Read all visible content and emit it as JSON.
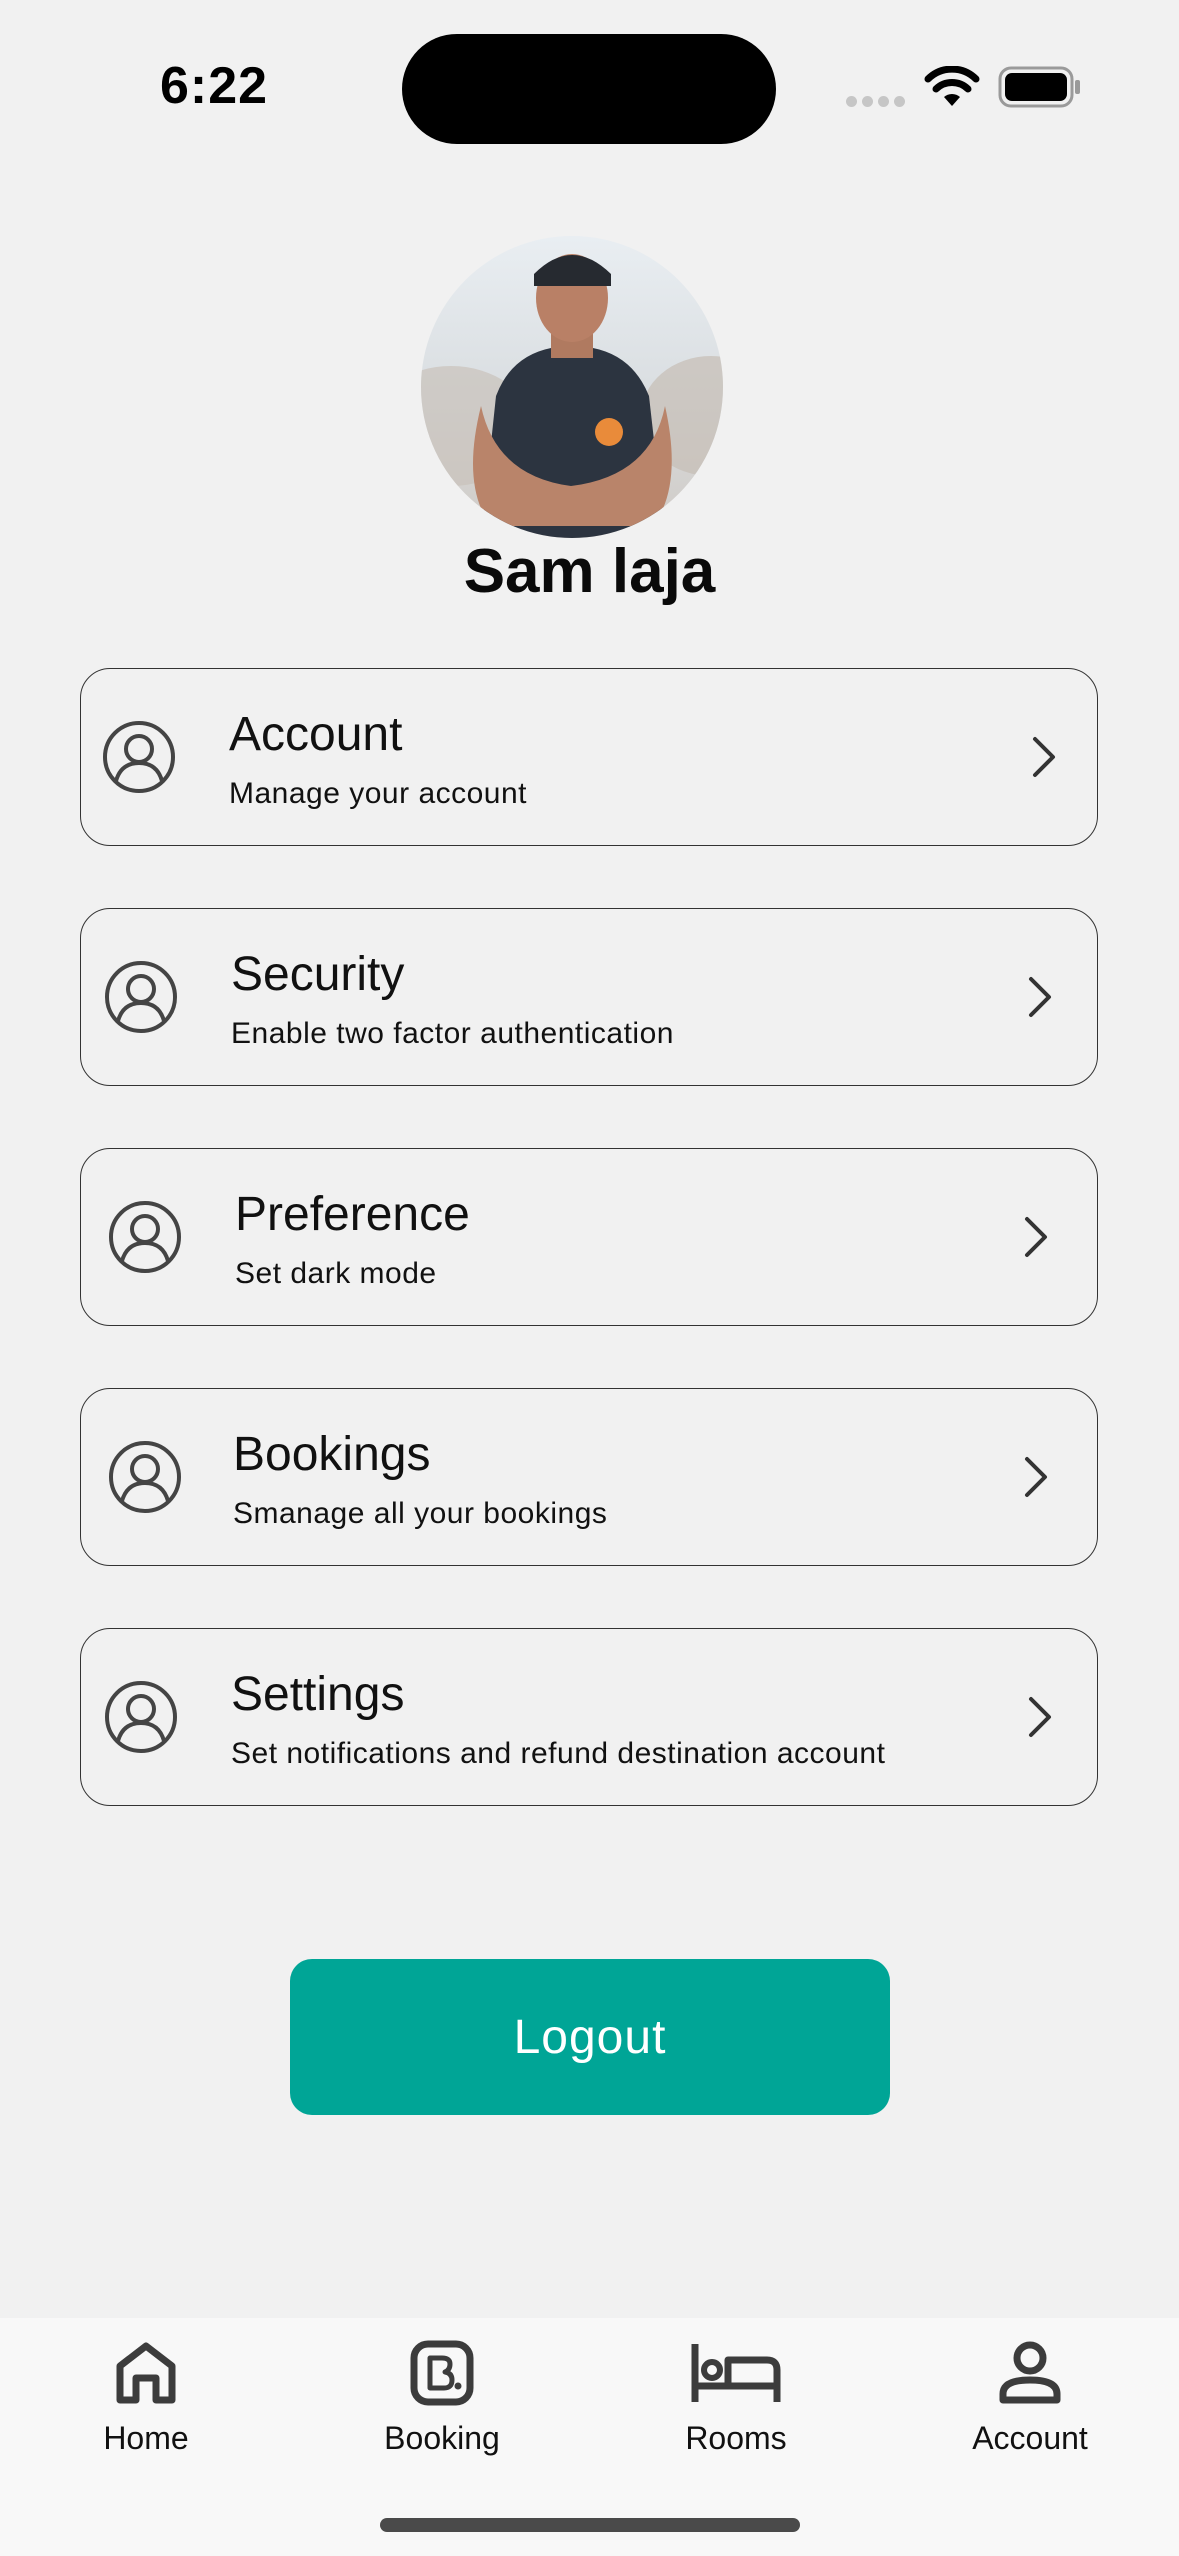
{
  "status_bar": {
    "time": "6:22"
  },
  "profile": {
    "name": "Sam laja"
  },
  "menu": [
    {
      "title": "Account",
      "subtitle": "Manage your account"
    },
    {
      "title": "Security",
      "subtitle": "Enable two factor authentication"
    },
    {
      "title": "Preference",
      "subtitle": "Set dark mode"
    },
    {
      "title": "Bookings",
      "subtitle": "Smanage all your bookings"
    },
    {
      "title": "Settings",
      "subtitle": "Set notifications and refund destination account"
    }
  ],
  "logout_label": "Logout",
  "tabs": [
    {
      "label": "Home",
      "icon": "home-icon"
    },
    {
      "label": "Booking",
      "icon": "booking-icon"
    },
    {
      "label": "Rooms",
      "icon": "bed-icon"
    },
    {
      "label": "Account",
      "icon": "person-icon"
    }
  ],
  "colors": {
    "accent": "#00a596",
    "background": "#f1f1f1",
    "tab_bar": "#f8f8f8"
  }
}
